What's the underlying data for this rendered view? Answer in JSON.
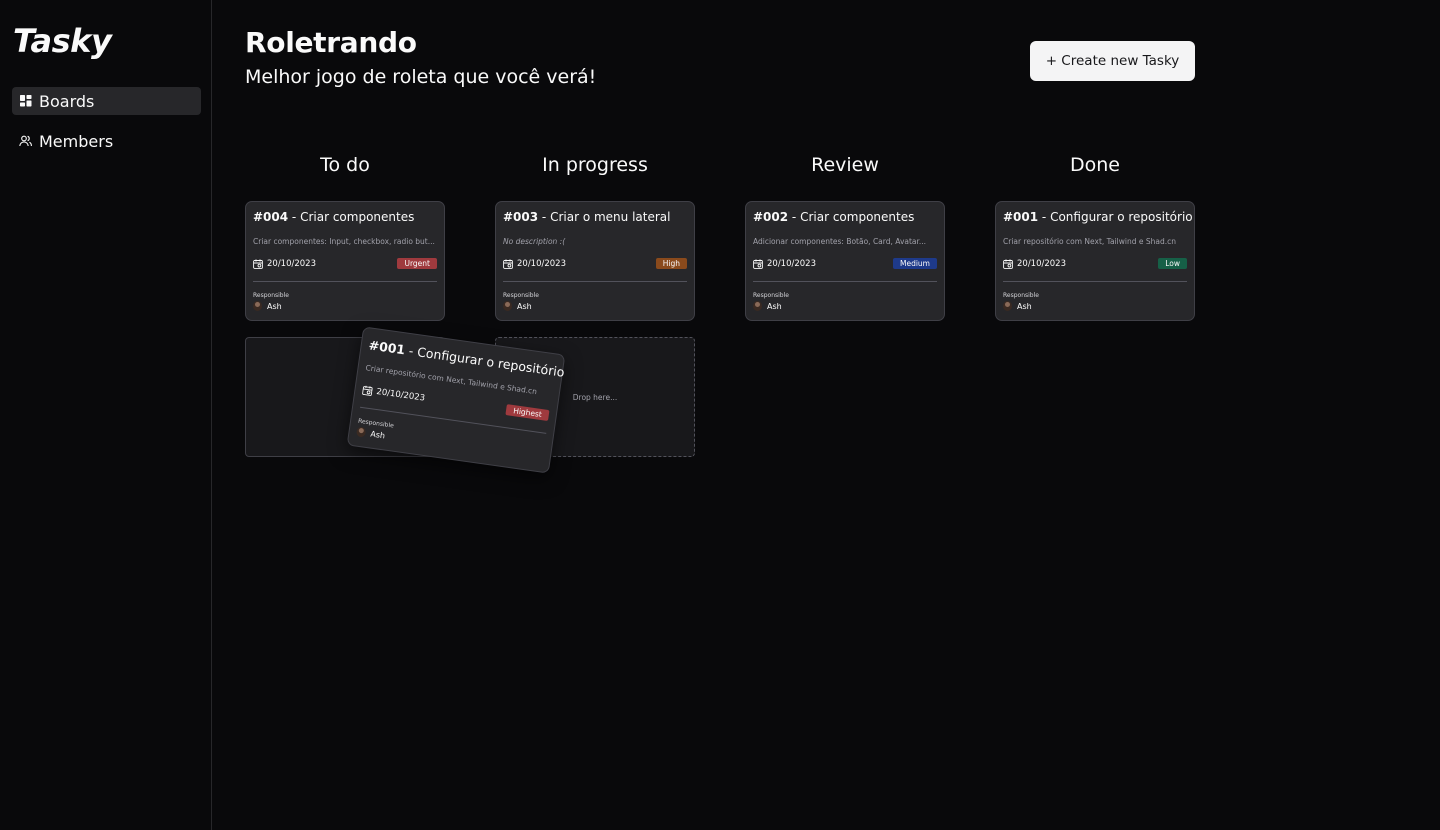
{
  "app": {
    "logo": "Tasky"
  },
  "sidebar": {
    "items": [
      {
        "label": "Boards",
        "icon": "dashboard-icon",
        "active": true
      },
      {
        "label": "Members",
        "icon": "users-icon",
        "active": false
      }
    ]
  },
  "header": {
    "title": "Roletrando",
    "subtitle": "Melhor jogo de roleta que você verá!",
    "create_button": "+ Create new Tasky"
  },
  "columns": [
    {
      "title": "To do",
      "cards": [
        {
          "id": "#004",
          "title": " - Criar componentes",
          "description": "Criar componentes: Input, checkbox, radio but...",
          "date": "20/10/2023",
          "priority": "Urgent",
          "priority_color": "#9f3a3e",
          "responsible_label": "Responsible",
          "responsible": "Ash"
        }
      ]
    },
    {
      "title": "In progress",
      "cards": [
        {
          "id": "#003",
          "title": " - Criar o menu lateral",
          "description": "No description :(",
          "date": "20/10/2023",
          "priority": "High",
          "priority_color": "#8a4a1c",
          "responsible_label": "Responsible",
          "responsible": "Ash"
        }
      ],
      "dropzone_text": "Drop here..."
    },
    {
      "title": "Review",
      "cards": [
        {
          "id": "#002",
          "title": " - Criar componentes",
          "description": "Adicionar componentes: Botão, Card, Avatar...",
          "date": "20/10/2023",
          "priority": "Medium",
          "priority_color": "#1e3a8a",
          "responsible_label": "Responsible",
          "responsible": "Ash"
        }
      ]
    },
    {
      "title": "Done",
      "cards": [
        {
          "id": "#001",
          "title": " - Configurar o repositório",
          "description": "Criar repositório com Next, Tailwind e Shad.cn",
          "date": "20/10/2023",
          "priority": "Low",
          "priority_color": "#166047",
          "responsible_label": "Responsible",
          "responsible": "Ash"
        }
      ]
    }
  ],
  "dragging_card": {
    "id": "#001",
    "title": " - Configurar o repositório",
    "description": "Criar repositório com Next, Tailwind e Shad.cn",
    "date": "20/10/2023",
    "priority": "Highest",
    "priority_color": "#9f3a3e",
    "responsible_label": "Responsible",
    "responsible": "Ash"
  }
}
